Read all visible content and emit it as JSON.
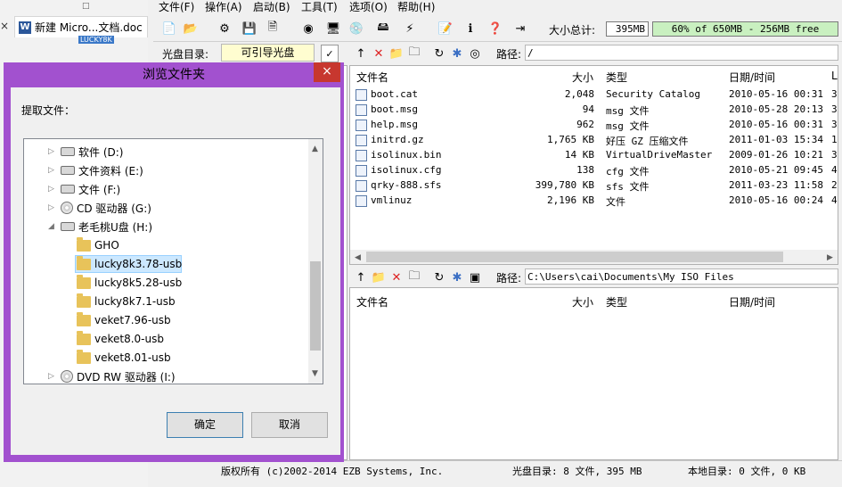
{
  "background_window": {
    "tab_title": "新建 Micro...文档.doc",
    "tab_close": "×",
    "restore_glyph": "□",
    "side_label": "LUCKY8K"
  },
  "menu": [
    "文件(F)",
    "操作(A)",
    "启动(B)",
    "工具(T)",
    "选项(O)",
    "帮助(H)"
  ],
  "toolbar": {
    "icons": [
      "new-icon",
      "open-icon",
      "extract-icon",
      "save-icon",
      "save-as-icon",
      "burn-icon",
      "image-icon",
      "cd-icon",
      "disk-icon",
      "gear-icon",
      "properties-icon",
      "info-icon",
      "help-icon",
      "exit-icon"
    ],
    "total_label": "大小总计:",
    "total_value": "395MB",
    "capacity_text": "60% of 650MB - 256MB free",
    "capacity_fraction": 0.6
  },
  "disc": {
    "label": "光盘目录:",
    "value": "可引导光盘"
  },
  "iso_pane": {
    "path_label": "路径:",
    "path": "/",
    "columns": {
      "name": "文件名",
      "size": "大小",
      "type": "类型",
      "date": "日期/时间",
      "extra": "L"
    },
    "files": [
      {
        "name": "boot.cat",
        "size": "2,048",
        "type": "Security Catalog",
        "date": "2010-05-16 00:31",
        "extra": "3"
      },
      {
        "name": "boot.msg",
        "size": "94",
        "type": "msg 文件",
        "date": "2010-05-28 20:13",
        "extra": "3"
      },
      {
        "name": "help.msg",
        "size": "962",
        "type": "msg 文件",
        "date": "2010-05-16 00:31",
        "extra": "3"
      },
      {
        "name": "initrd.gz",
        "size": "1,765 KB",
        "type": "好压 GZ 压缩文件",
        "date": "2011-01-03 15:34",
        "extra": "1"
      },
      {
        "name": "isolinux.bin",
        "size": "14 KB",
        "type": "VirtualDriveMaster",
        "date": "2009-01-26 10:21",
        "extra": "3"
      },
      {
        "name": "isolinux.cfg",
        "size": "138",
        "type": "cfg 文件",
        "date": "2010-05-21 09:45",
        "extra": "4"
      },
      {
        "name": "qrky-888.sfs",
        "size": "399,780 KB",
        "type": "sfs 文件",
        "date": "2011-03-23 11:58",
        "extra": "2"
      },
      {
        "name": "vmlinuz",
        "size": "2,196 KB",
        "type": "文件",
        "date": "2010-05-16 00:24",
        "extra": "4"
      }
    ]
  },
  "local_pane": {
    "path_label": "路径:",
    "path": "C:\\Users\\cai\\Documents\\My ISO Files",
    "columns": {
      "name": "文件名",
      "size": "大小",
      "type": "类型",
      "date": "日期/时间"
    }
  },
  "status": {
    "copyright": "版权所有 (c)2002-2014 EZB Systems, Inc.",
    "disc_summary": "光盘目录: 8 文件, 395 MB",
    "local_summary": "本地目录: 0 文件, 0 KB"
  },
  "dialog": {
    "title": "浏览文件夹",
    "close": "×",
    "prompt": "提取文件：",
    "tree": [
      {
        "label": "软件 (D:)",
        "kind": "drive",
        "level": 0,
        "expander": "▷"
      },
      {
        "label": "文件资料 (E:)",
        "kind": "drive",
        "level": 0,
        "expander": "▷"
      },
      {
        "label": "文件 (F:)",
        "kind": "drive",
        "level": 0,
        "expander": "▷"
      },
      {
        "label": "CD 驱动器 (G:)",
        "kind": "cd",
        "level": 0,
        "expander": "▷"
      },
      {
        "label": "老毛桃U盘 (H:)",
        "kind": "usb",
        "level": 0,
        "expander": "◢"
      },
      {
        "label": "GHO",
        "kind": "folder-special",
        "level": 1,
        "expander": ""
      },
      {
        "label": "lucky8k3.78-usb",
        "kind": "folder",
        "level": 1,
        "expander": "",
        "selected": true
      },
      {
        "label": "lucky8k5.28-usb",
        "kind": "folder",
        "level": 1,
        "expander": ""
      },
      {
        "label": "lucky8k7.1-usb",
        "kind": "folder",
        "level": 1,
        "expander": ""
      },
      {
        "label": "veket7.96-usb",
        "kind": "folder",
        "level": 1,
        "expander": ""
      },
      {
        "label": "veket8.0-usb",
        "kind": "folder",
        "level": 1,
        "expander": ""
      },
      {
        "label": "veket8.01-usb",
        "kind": "folder",
        "level": 1,
        "expander": ""
      },
      {
        "label": "DVD RW 驱动器 (I:)",
        "kind": "cd",
        "level": 0,
        "expander": "▷"
      }
    ],
    "ok": "确定",
    "cancel": "取消"
  }
}
